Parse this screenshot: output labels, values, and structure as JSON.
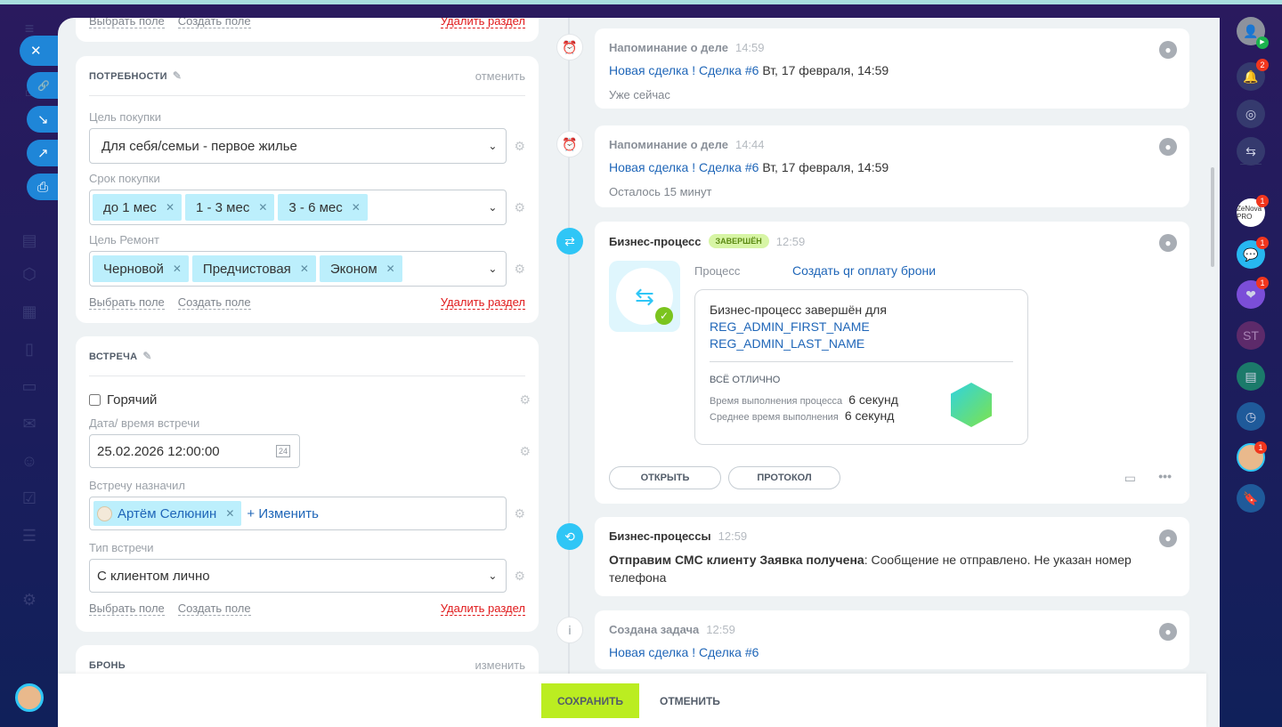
{
  "left_sidebar": {
    "avatar": "user-avatar"
  },
  "fabs": {
    "close": "✕",
    "link": "🔗",
    "download": "↘",
    "open": "↗",
    "print": "⎙"
  },
  "top_card": {
    "select_field": "Выбрать поле",
    "create_field": "Создать поле",
    "delete_section": "Удалить раздел"
  },
  "needs": {
    "title": "ПОТРЕБНОСТИ",
    "action": "отменить",
    "purpose_label": "Цель покупки",
    "purpose_value": "Для себя/семьи - первое жилье",
    "term_label": "Срок покупки",
    "term_tags": [
      "до 1 мес",
      "1 - 3 мес",
      "3 - 6 мес"
    ],
    "repair_label": "Цель Ремонт",
    "repair_tags": [
      "Черновой",
      "Предчистовая",
      "Эконом"
    ],
    "select_field": "Выбрать поле",
    "create_field": "Создать поле",
    "delete_section": "Удалить раздел"
  },
  "meeting": {
    "title": "ВСТРЕЧА",
    "hot_label": "Горячий",
    "hot_checked": false,
    "date_label": "Дата/ время встречи",
    "date_value": "25.02.2026 12:00:00",
    "calendar_day": "24",
    "assigned_label": "Встречу назначил",
    "assigned_user": "Артём Селюнин",
    "change": "+ Изменить",
    "type_label": "Тип встречи",
    "type_value": "С клиентом лично",
    "select_field": "Выбрать поле",
    "create_field": "Создать поле",
    "delete_section": "Удалить раздел"
  },
  "booking": {
    "title": "БРОНЬ",
    "action": "изменить"
  },
  "timeline": [
    {
      "title": "Напоминание о деле",
      "time": "14:59",
      "link": "Новая сделка ! Сделка #6",
      "date": "Вт, 17 февраля, 14:59",
      "sub": "Уже сейчас"
    },
    {
      "title": "Напоминание о деле",
      "time": "14:44",
      "link": "Новая сделка ! Сделка #6",
      "date": "Вт, 17 февраля, 14:59",
      "sub": "Осталось 15 минут"
    },
    {
      "title": "Бизнес-процесс",
      "badge": "ЗАВЕРШЁН",
      "time": "12:59",
      "process_label": "Процесс",
      "process_name": "Создать qr оплату брони",
      "finished_for": "Бизнес-процесс завершён для",
      "first_name": "REG_ADMIN_FIRST_NAME",
      "last_name": "REG_ADMIN_LAST_NAME",
      "status": "ВСЁ ОТЛИЧНО",
      "exec_label": "Время выполнения процесса",
      "exec_value": "6 секунд",
      "avg_label": "Среднее время выполнения",
      "avg_value": "6 секунд",
      "open": "ОТКРЫТЬ",
      "protocol": "ПРОТОКОЛ"
    },
    {
      "title": "Бизнес-процессы",
      "time": "12:59",
      "bold": "Отправим СМС клиенту Заявка получена",
      "text": ": Сообщение не отправлено. Не указан номер телефона"
    },
    {
      "title": "Создана задача",
      "time": "12:59",
      "link": "Новая сделка ! Сделка #6"
    }
  ],
  "footer": {
    "save": "СОХРАНИТЬ",
    "cancel": "ОТМЕНИТЬ"
  },
  "right_sidebar": {
    "notifications_count": "2",
    "apps": [
      {
        "label": "ZeNova PRO",
        "badge": "1"
      },
      {
        "label": "chat",
        "badge": "1"
      },
      {
        "label": "heart",
        "badge": "1"
      },
      {
        "label": "ST"
      },
      {
        "label": "news"
      },
      {
        "label": "time"
      },
      {
        "label": "user",
        "badge": "1"
      },
      {
        "label": "bookmark"
      }
    ]
  },
  "colors": {
    "accent": "#2fc6f6",
    "save": "#bbed21",
    "link": "#1f66b8",
    "danger": "#e0191b"
  }
}
